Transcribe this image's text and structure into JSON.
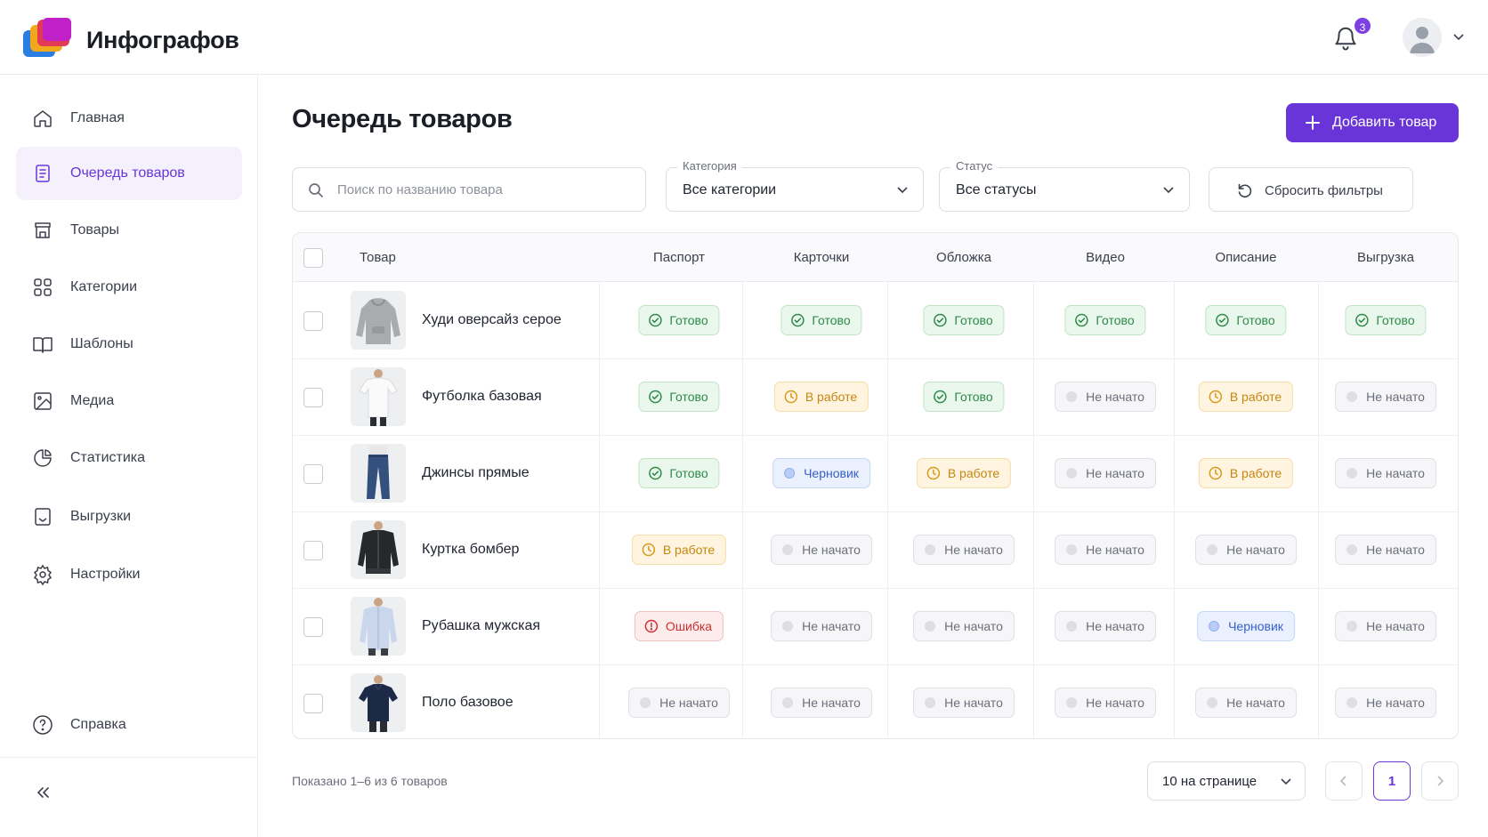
{
  "app": {
    "brand": "Инфографов",
    "notifications_count": "3"
  },
  "sidebar": {
    "items": [
      {
        "label": "Главная",
        "icon": "home-icon"
      },
      {
        "label": "Очередь товаров",
        "icon": "queue-list-icon",
        "active": true
      },
      {
        "label": "Товары",
        "icon": "store-icon"
      },
      {
        "label": "Категории",
        "icon": "grid-icon"
      },
      {
        "label": "Шаблоны",
        "icon": "book-icon"
      },
      {
        "label": "Медиа",
        "icon": "image-icon"
      },
      {
        "label": "Статистика",
        "icon": "pie-chart-icon"
      },
      {
        "label": "Выгрузки",
        "icon": "export-icon"
      },
      {
        "label": "Настройки",
        "icon": "gear-icon"
      }
    ],
    "help_label": "Справка"
  },
  "main": {
    "title": "Очередь товаров",
    "add_button": "Добавить товар",
    "search_placeholder": "Поиск по названию товара",
    "category": {
      "label": "Категория",
      "value": "Все категории"
    },
    "status": {
      "label": "Статус",
      "value": "Все статусы"
    },
    "reset_label": "Сбросить фильтры"
  },
  "table": {
    "columns": [
      "Товар",
      "Паспорт",
      "Карточки",
      "Обложка",
      "Видео",
      "Описание",
      "Выгрузка"
    ],
    "status_labels": {
      "ready": "Готово",
      "work": "В работе",
      "none": "Не начато",
      "draft": "Черновик",
      "err": "Ошибка"
    },
    "rows": [
      {
        "name": "Худи оверсайз серое",
        "product": "hoodie",
        "statuses": [
          "ready",
          "ready",
          "ready",
          "ready",
          "ready",
          "ready"
        ]
      },
      {
        "name": "Футболка базовая",
        "product": "tshirt",
        "statuses": [
          "ready",
          "work",
          "ready",
          "none",
          "work",
          "none"
        ]
      },
      {
        "name": "Джинсы прямые",
        "product": "jeans",
        "statuses": [
          "ready",
          "draft",
          "work",
          "none",
          "work",
          "none"
        ]
      },
      {
        "name": "Куртка бомбер",
        "product": "bomber",
        "statuses": [
          "work",
          "none",
          "none",
          "none",
          "none",
          "none"
        ]
      },
      {
        "name": "Рубашка мужская",
        "product": "shirt",
        "statuses": [
          "err",
          "none",
          "none",
          "none",
          "draft",
          "none"
        ]
      },
      {
        "name": "Поло базовое",
        "product": "polo",
        "statuses": [
          "none",
          "none",
          "none",
          "none",
          "none",
          "none"
        ]
      }
    ]
  },
  "footer": {
    "shown_text": "Показано 1–6 из 6 товаров",
    "per_page": "10 на странице",
    "current_page": "1"
  },
  "colors": {
    "accent": "#6a35d8",
    "ready": "#2e8b47",
    "work": "#c58612",
    "draft": "#3561c9",
    "error": "#cf2f2f"
  }
}
